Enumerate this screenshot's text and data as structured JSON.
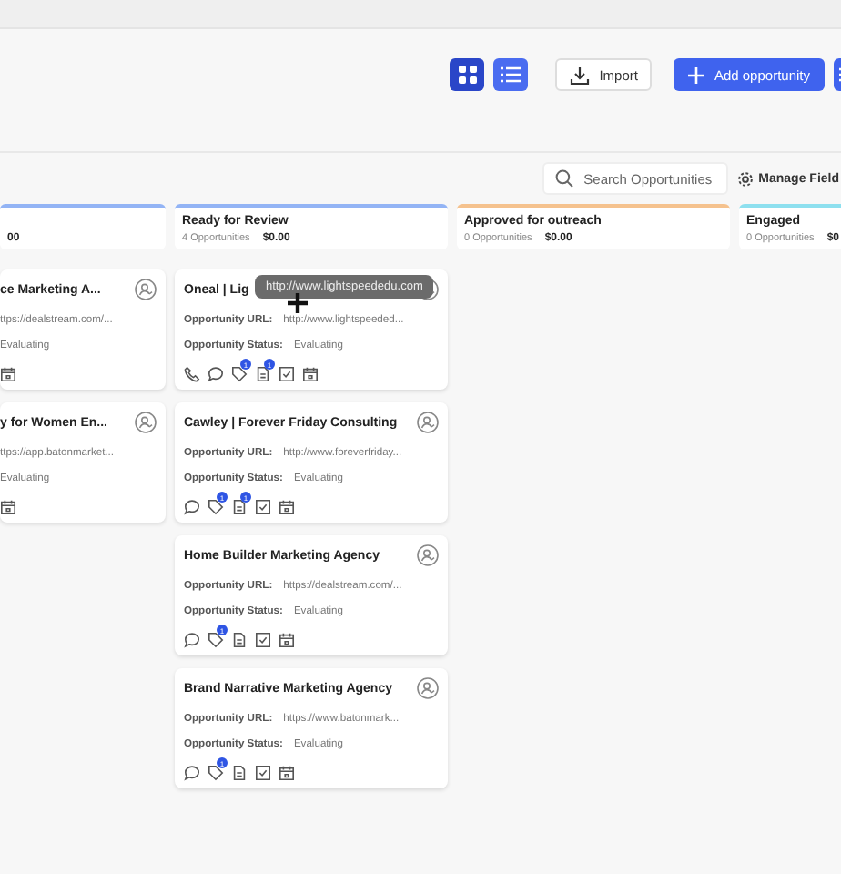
{
  "toolbar": {
    "views": [
      {
        "kind": "grid",
        "selected": true
      },
      {
        "kind": "list",
        "selected": false
      }
    ],
    "import_button": "Import",
    "add_button": "Add opportunity"
  },
  "search": {
    "placeholder": "Search Opportunities"
  },
  "manage_fields": "Manage Field",
  "columns": [
    {
      "value": "00",
      "color": "#93b4f5",
      "cards": [
        {
          "title": "ce Marketing A...",
          "url": "ttps://dealstream.com/...",
          "status": "Evaluating",
          "icons": [
            {
              "kind": "calendar"
            }
          ]
        },
        {
          "title": "y for Women En...",
          "url": "ttps://app.batonmarket...",
          "status": "Evaluating",
          "icons": [
            {
              "kind": "calendar"
            }
          ]
        }
      ]
    },
    {
      "name": "Ready for Review",
      "count": "4 Opportunities",
      "value": "$0.00",
      "color": "#93b4f5",
      "cards": [
        {
          "title": "Oneal | Lig",
          "url_label": "Opportunity URL:",
          "url": "http://www.lightspeeded...",
          "status_label": "Opportunity Status:",
          "status": "Evaluating",
          "tooltip": "http://www.lightspeededu.com",
          "icons": [
            {
              "kind": "phone"
            },
            {
              "kind": "chat"
            },
            {
              "kind": "tag",
              "badge": "1"
            },
            {
              "kind": "doc",
              "badge": "1"
            },
            {
              "kind": "check"
            },
            {
              "kind": "calendar"
            }
          ]
        },
        {
          "title": "Cawley | Forever Friday Consulting",
          "url_label": "Opportunity URL:",
          "url": "http://www.foreverfriday...",
          "status_label": "Opportunity Status:",
          "status": "Evaluating",
          "icons": [
            {
              "kind": "chat"
            },
            {
              "kind": "tag",
              "badge": "1"
            },
            {
              "kind": "doc",
              "badge": "1"
            },
            {
              "kind": "check"
            },
            {
              "kind": "calendar"
            }
          ]
        },
        {
          "title": "Home Builder Marketing Agency",
          "url_label": "Opportunity URL:",
          "url": "https://dealstream.com/...",
          "status_label": "Opportunity Status:",
          "status": "Evaluating",
          "icons": [
            {
              "kind": "chat"
            },
            {
              "kind": "tag",
              "badge": "1"
            },
            {
              "kind": "doc"
            },
            {
              "kind": "check"
            },
            {
              "kind": "calendar"
            }
          ]
        },
        {
          "title": "Brand Narrative Marketing Agency",
          "url_label": "Opportunity URL:",
          "url": "https://www.batonmark...",
          "status_label": "Opportunity Status:",
          "status": "Evaluating",
          "icons": [
            {
              "kind": "chat"
            },
            {
              "kind": "tag",
              "badge": "1"
            },
            {
              "kind": "doc"
            },
            {
              "kind": "check"
            },
            {
              "kind": "calendar"
            }
          ]
        }
      ]
    },
    {
      "name": "Approved for outreach",
      "count": "0 Opportunities",
      "value": "$0.00",
      "color": "#f5c28e"
    },
    {
      "name": "Engaged",
      "count": "0 Opportunities",
      "value": "$0",
      "color": "#8ee0ef"
    }
  ]
}
